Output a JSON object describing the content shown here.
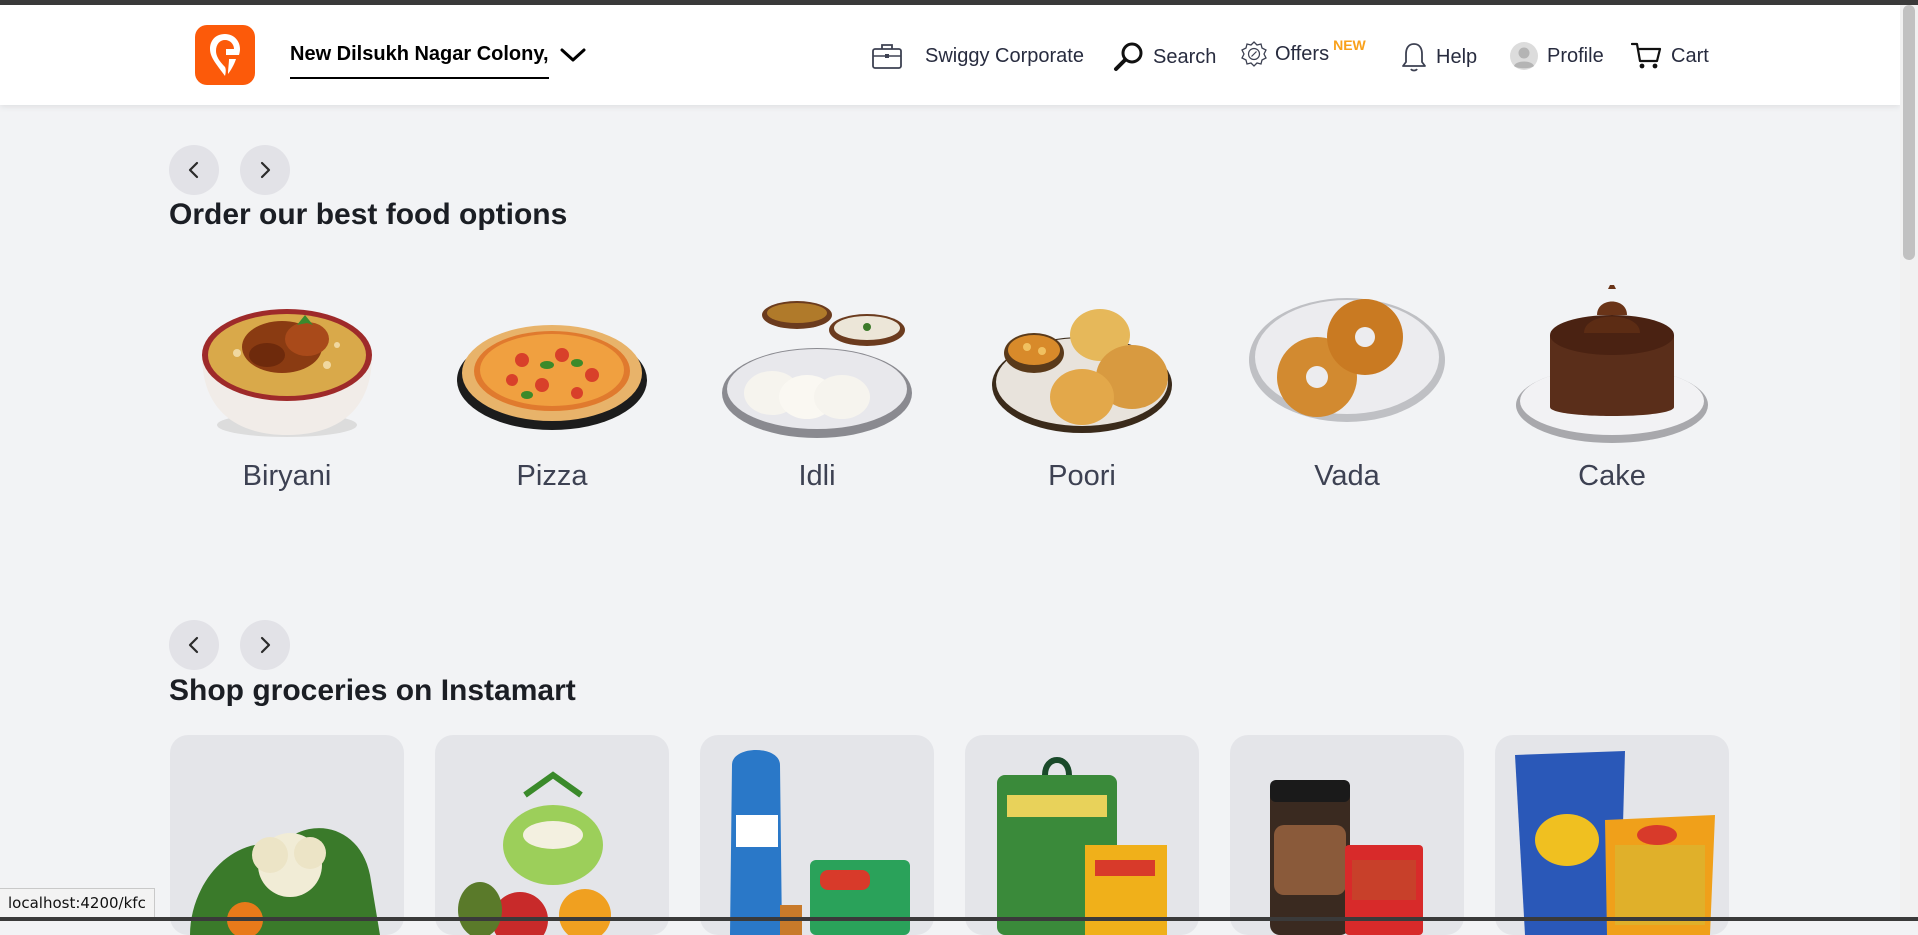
{
  "header": {
    "location": "New Dilsukh Nagar Colony,",
    "nav": {
      "corporate": "Swiggy Corporate",
      "search": "Search",
      "offers": "Offers",
      "offers_badge": "NEW",
      "help": "Help",
      "profile": "Profile",
      "cart": "Cart"
    },
    "brand_color": "#fc5a0a"
  },
  "food_section": {
    "title": "Order our best food options",
    "items": [
      {
        "label": "Biryani",
        "icon": "biryani-image"
      },
      {
        "label": "Pizza",
        "icon": "pizza-image"
      },
      {
        "label": "Idli",
        "icon": "idli-image"
      },
      {
        "label": "Poori",
        "icon": "poori-image"
      },
      {
        "label": "Vada",
        "icon": "vada-image"
      },
      {
        "label": "Cake",
        "icon": "cake-image"
      }
    ]
  },
  "grocery_section": {
    "title": "Shop groceries on Instamart",
    "items": [
      {
        "icon": "vegetables-image"
      },
      {
        "icon": "fruits-image"
      },
      {
        "icon": "dairy-bread-image"
      },
      {
        "icon": "rice-atta-image"
      },
      {
        "icon": "dry-fruits-masala-image"
      },
      {
        "icon": "snacks-image"
      }
    ]
  },
  "status_bar": {
    "url": "localhost:4200/kfc"
  }
}
